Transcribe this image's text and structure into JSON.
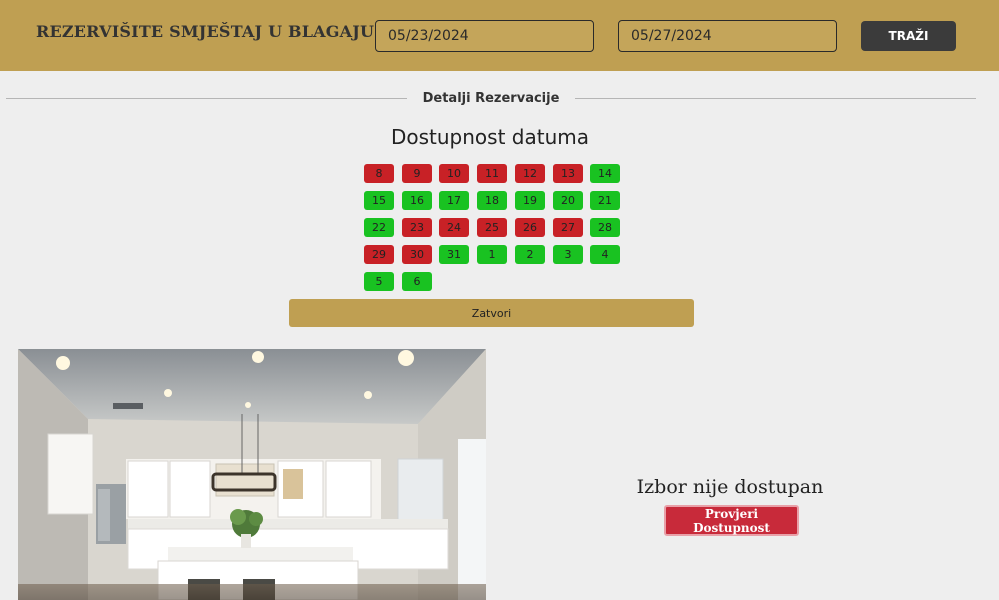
{
  "header": {
    "title": "REZERVIŠITE SMJEŠTAJ U BLAGAJU",
    "checkin_value": "05/23/2024",
    "checkout_value": "05/27/2024",
    "search_label": "TRAŽI"
  },
  "section": {
    "divider_label": "Detalji Rezervacije",
    "availability_title": "Dostupnost datuma"
  },
  "calendar": {
    "colors": {
      "busy": "#c82126",
      "free": "#19c221"
    },
    "days": [
      {
        "label": "8",
        "status": "busy"
      },
      {
        "label": "9",
        "status": "busy"
      },
      {
        "label": "10",
        "status": "busy"
      },
      {
        "label": "11",
        "status": "busy"
      },
      {
        "label": "12",
        "status": "busy"
      },
      {
        "label": "13",
        "status": "busy"
      },
      {
        "label": "14",
        "status": "free"
      },
      {
        "label": "15",
        "status": "free"
      },
      {
        "label": "16",
        "status": "free"
      },
      {
        "label": "17",
        "status": "free"
      },
      {
        "label": "18",
        "status": "free"
      },
      {
        "label": "19",
        "status": "free"
      },
      {
        "label": "20",
        "status": "free"
      },
      {
        "label": "21",
        "status": "free"
      },
      {
        "label": "22",
        "status": "free"
      },
      {
        "label": "23",
        "status": "busy"
      },
      {
        "label": "24",
        "status": "busy"
      },
      {
        "label": "25",
        "status": "busy"
      },
      {
        "label": "26",
        "status": "busy"
      },
      {
        "label": "27",
        "status": "busy"
      },
      {
        "label": "28",
        "status": "free"
      },
      {
        "label": "29",
        "status": "busy"
      },
      {
        "label": "30",
        "status": "busy"
      },
      {
        "label": "31",
        "status": "free"
      },
      {
        "label": "1",
        "status": "free"
      },
      {
        "label": "2",
        "status": "free"
      },
      {
        "label": "3",
        "status": "free"
      },
      {
        "label": "4",
        "status": "free"
      },
      {
        "label": "5",
        "status": "free"
      },
      {
        "label": "6",
        "status": "free"
      }
    ],
    "close_label": "Zatvori"
  },
  "result": {
    "message": "Izbor nije dostupan",
    "check_label": "Provjeri Dostupnost"
  }
}
